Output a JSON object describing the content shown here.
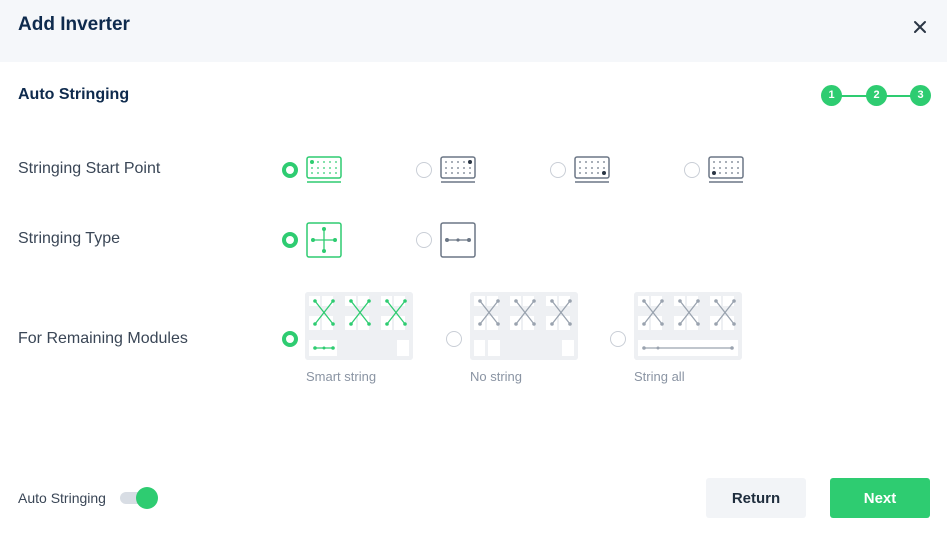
{
  "dialog": {
    "title": "Add Inverter",
    "close_icon": "close-icon"
  },
  "section": {
    "title": "Auto Stringing"
  },
  "stepper": {
    "steps": [
      "1",
      "2",
      "3"
    ],
    "current": 3,
    "color": "#2ecc71"
  },
  "stringing_start_point": {
    "label": "Stringing Start Point",
    "options": [
      {
        "icon": "grid-start-top-left-icon",
        "selected": true
      },
      {
        "icon": "grid-start-top-right-icon",
        "selected": false
      },
      {
        "icon": "grid-start-bottom-right-icon",
        "selected": false
      },
      {
        "icon": "grid-start-bottom-left-icon",
        "selected": false
      }
    ]
  },
  "stringing_type": {
    "label": "Stringing Type",
    "options": [
      {
        "icon": "cross-stringing-icon",
        "selected": true
      },
      {
        "icon": "linear-stringing-icon",
        "selected": false
      }
    ]
  },
  "remaining_modules": {
    "label": "For Remaining Modules",
    "options": [
      {
        "caption": "Smart string",
        "icon": "smart-string-icon",
        "selected": true
      },
      {
        "caption": "No string",
        "icon": "no-string-icon",
        "selected": false
      },
      {
        "caption": "String all",
        "icon": "string-all-icon",
        "selected": false
      }
    ]
  },
  "footer": {
    "toggle_label": "Auto Stringing",
    "toggle_on": true,
    "return_label": "Return",
    "next_label": "Next"
  },
  "colors": {
    "accent": "#2ecc71",
    "title": "#0e2a4d",
    "header_bg": "#f5f7fa",
    "inactive": "#6b7685"
  }
}
